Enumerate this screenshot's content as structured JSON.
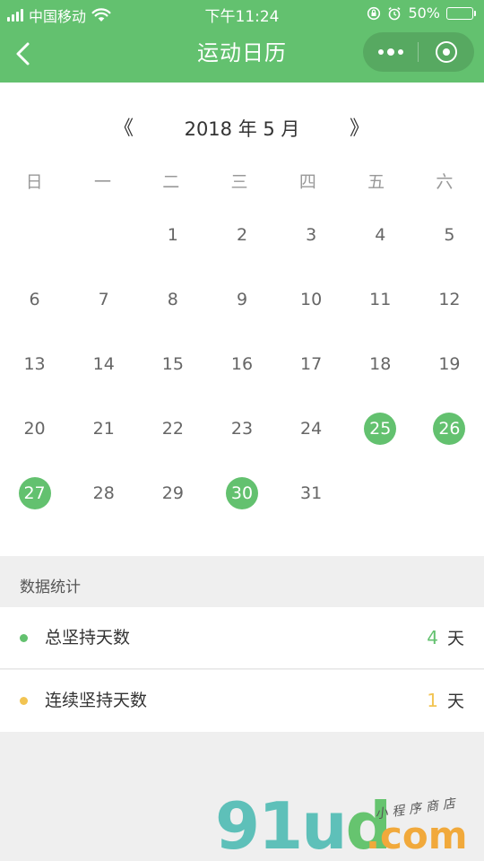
{
  "status_bar": {
    "carrier": "中国移动",
    "time": "下午11:24",
    "battery_percent": "50%",
    "battery_level": 0.5,
    "battery_color": "#f6d33a"
  },
  "nav": {
    "title": "运动日历",
    "back_icon": "chevron-left-icon",
    "more_icon": "more-dots-icon",
    "close_icon": "target-circle-icon",
    "bar_color": "#63c16f"
  },
  "calendar": {
    "prev_label": "《",
    "next_label": "》",
    "month_label": "2018 年 5 月",
    "weekdays": [
      "日",
      "一",
      "二",
      "三",
      "四",
      "五",
      "六"
    ],
    "first_weekday_index": 2,
    "days": [
      "1",
      "2",
      "3",
      "4",
      "5",
      "6",
      "7",
      "8",
      "9",
      "10",
      "11",
      "12",
      "13",
      "14",
      "15",
      "16",
      "17",
      "18",
      "19",
      "20",
      "21",
      "22",
      "23",
      "24",
      "25",
      "26",
      "27",
      "28",
      "29",
      "30",
      "31"
    ],
    "active_days": [
      "25",
      "26",
      "27",
      "30"
    ],
    "active_color": "#63c16f"
  },
  "stats": {
    "title": "数据统计",
    "items": [
      {
        "label": "总坚持天数",
        "value": "4",
        "unit": "天",
        "color": "#63c16f"
      },
      {
        "label": "连续坚持天数",
        "value": "1",
        "unit": "天",
        "color": "#f2c452"
      }
    ]
  },
  "watermark": {
    "logo_main": "91u",
    "logo_d": "d",
    "logo_com": ".com",
    "logo_sub": "小程序商店"
  }
}
